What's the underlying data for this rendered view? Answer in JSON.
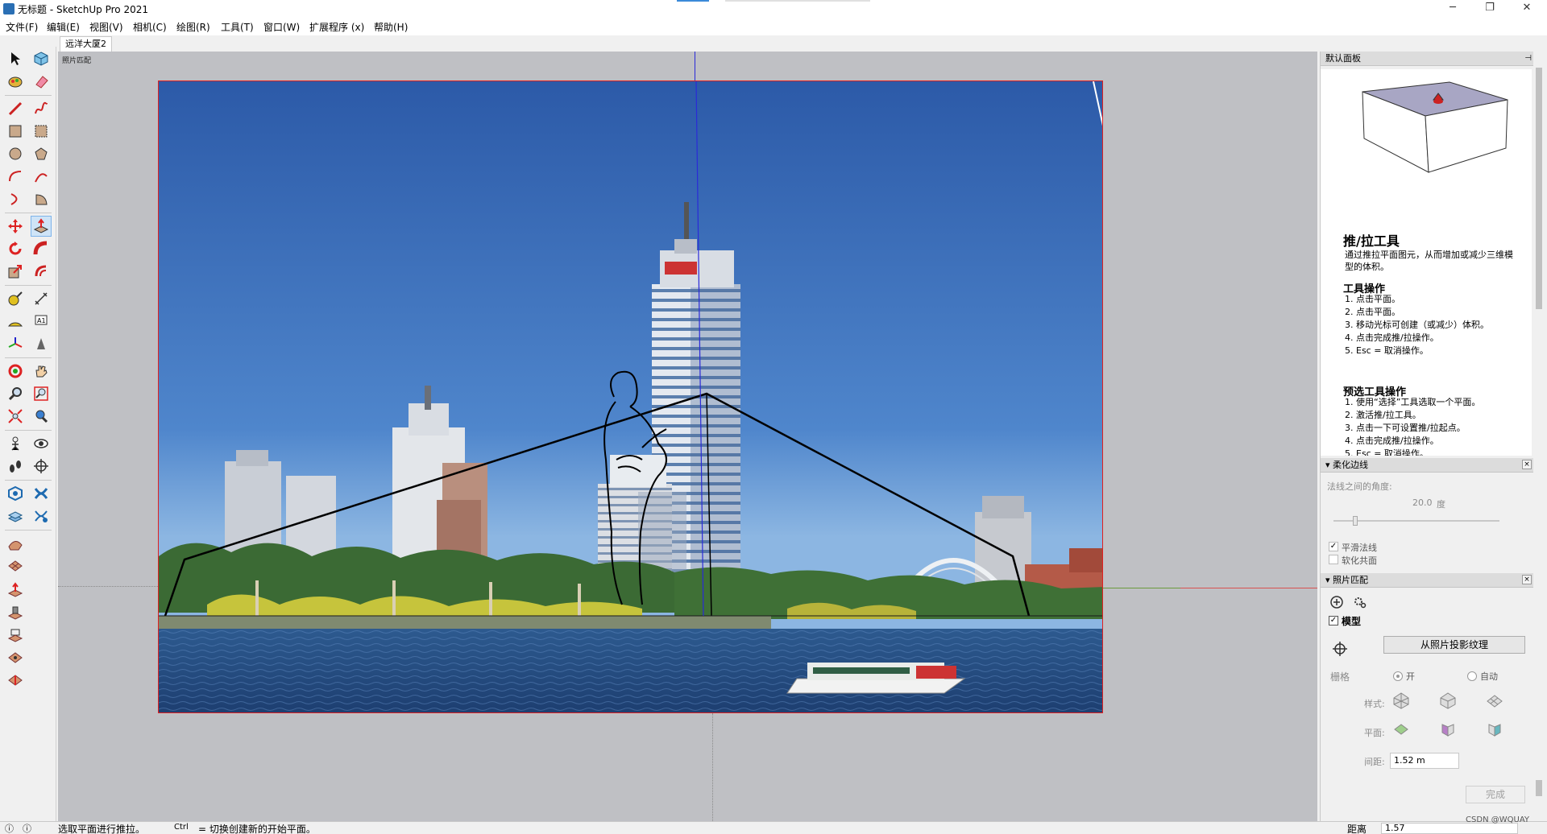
{
  "window": {
    "title": "无标题 - SketchUp Pro 2021",
    "minimize": "─",
    "maximize": "❐",
    "close": "✕"
  },
  "menu": [
    "文件(F)",
    "编辑(E)",
    "视图(V)",
    "相机(C)",
    "绘图(R)",
    "工具(T)",
    "窗口(W)",
    "扩展程序 (x)",
    "帮助(H)"
  ],
  "scene_tab": "远洋大厦2",
  "viewport": {
    "scene_label": "照片匹配"
  },
  "default_tray": {
    "title": "默认面板",
    "pin": "⊣"
  },
  "instructor": {
    "tool_title": "推/拉工具",
    "description": "通过推拉平面图元，从而增加或减少三维模型的体积。",
    "ops_title": "工具操作",
    "ops": [
      "1. 点击平面。",
      "2. 点击平面。",
      "3. 移动光标可创建（或减少）体积。",
      "4. 点击完成推/拉操作。",
      "5. Esc = 取消操作。"
    ],
    "presel_title": "预选工具操作",
    "presel": [
      "1. 使用“选择”工具选取一个平面。",
      "2. 激活推/拉工具。",
      "3. 点击一下可设置推/拉起点。",
      "4. 点击完成推/拉操作。",
      "5. Esc = 取消操作。"
    ]
  },
  "soften_edges": {
    "title": "柔化边线",
    "angle_label": "法线之间的角度:",
    "angle_value": "20.0",
    "angle_unit": "度",
    "smooth_normals": "平滑法线",
    "soften_coplanar": "软化共面",
    "slider_fraction": 0.12
  },
  "match_photo": {
    "title": "照片匹配",
    "model_label": "模型",
    "project_button": "从照片投影纹理",
    "grid_label": "栅格",
    "grid_on": "开",
    "grid_auto": "自动",
    "style_label": "样式:",
    "plane_label": "平面:",
    "spacing_label": "间距:",
    "spacing_value": "1.52 m",
    "done_button": "完成"
  },
  "status": {
    "left_hint": "选取平面进行推拉。",
    "ctrl_key": "Ctrl",
    "ctrl_hint": "= 切换创建新的开始平面。",
    "measure_label": "距离",
    "measure_value": "1.57"
  },
  "watermark": "CSDN @WQUAY",
  "colors": {
    "active_tool_bg": "#cfe4f7",
    "axis_red": "#d85050",
    "axis_blue": "#2a2ad8",
    "axis_green": "#6a9a3e",
    "photo_border": "#e02020"
  }
}
